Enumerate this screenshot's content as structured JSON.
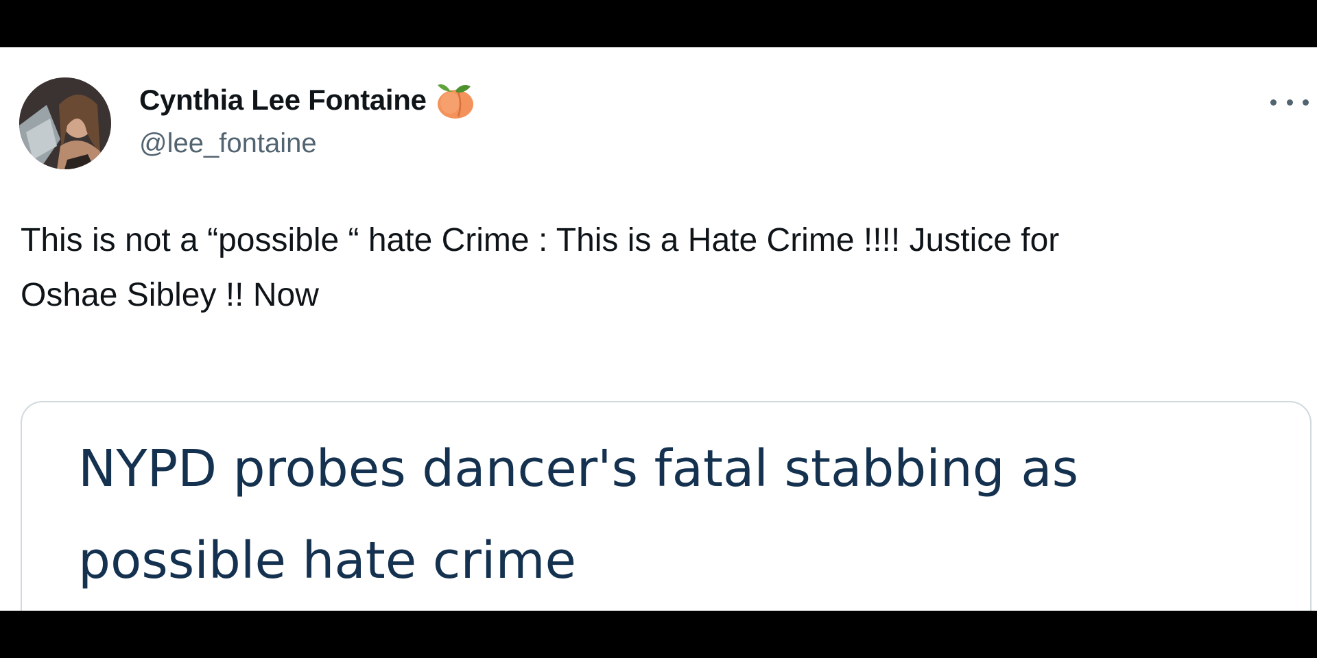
{
  "tweet": {
    "author": {
      "display_name": "Cynthia Lee Fontaine",
      "handle": "@lee_fontaine",
      "badge_icon": "peach-emoji",
      "avatar": "profile-photo"
    },
    "menu_icon": "more-horizontal-icon",
    "text_line1": "This is not a “possible “ hate Crime : This is a Hate Crime !!!!  Justice for",
    "text_line2": "Oshae Sibley !! Now",
    "link_card": {
      "headline_line1": "NYPD probes dancer's fatal stabbing as",
      "headline_line2": "possible hate crime"
    }
  },
  "colors": {
    "background": "#ffffff",
    "letterbox": "#000000",
    "primary_text": "#0f1419",
    "secondary_text": "#536471",
    "card_border": "#cfd9de",
    "headline_text": "#14314f"
  }
}
